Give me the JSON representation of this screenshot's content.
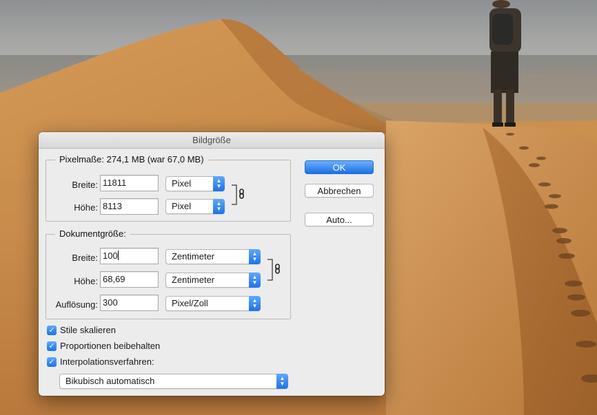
{
  "dialog": {
    "title": "Bildgröße",
    "pixel_section": {
      "legend": "Pixelmaße: 274,1 MB (war 67,0 MB)",
      "width_label": "Breite:",
      "width_value": "11811",
      "width_unit": "Pixel",
      "height_label": "Höhe:",
      "height_value": "8113",
      "height_unit": "Pixel"
    },
    "document_section": {
      "legend": "Dokumentgröße:",
      "width_label": "Breite:",
      "width_value": "100",
      "width_unit": "Zentimeter",
      "height_label": "Höhe:",
      "height_value": "68,69",
      "height_unit": "Zentimeter",
      "resolution_label": "Auflösung:",
      "resolution_value": "300",
      "resolution_unit": "Pixel/Zoll"
    },
    "checkboxes": {
      "scale_styles": "Stile skalieren",
      "constrain_proportions": "Proportionen beibehalten",
      "resample": "Interpolationsverfahren:"
    },
    "resample_method": "Bikubisch automatisch",
    "buttons": {
      "ok": "OK",
      "cancel": "Abbrechen",
      "auto": "Auto..."
    }
  },
  "colors": {
    "accent": "#1e72e8",
    "dialog_bg": "#ececec"
  }
}
